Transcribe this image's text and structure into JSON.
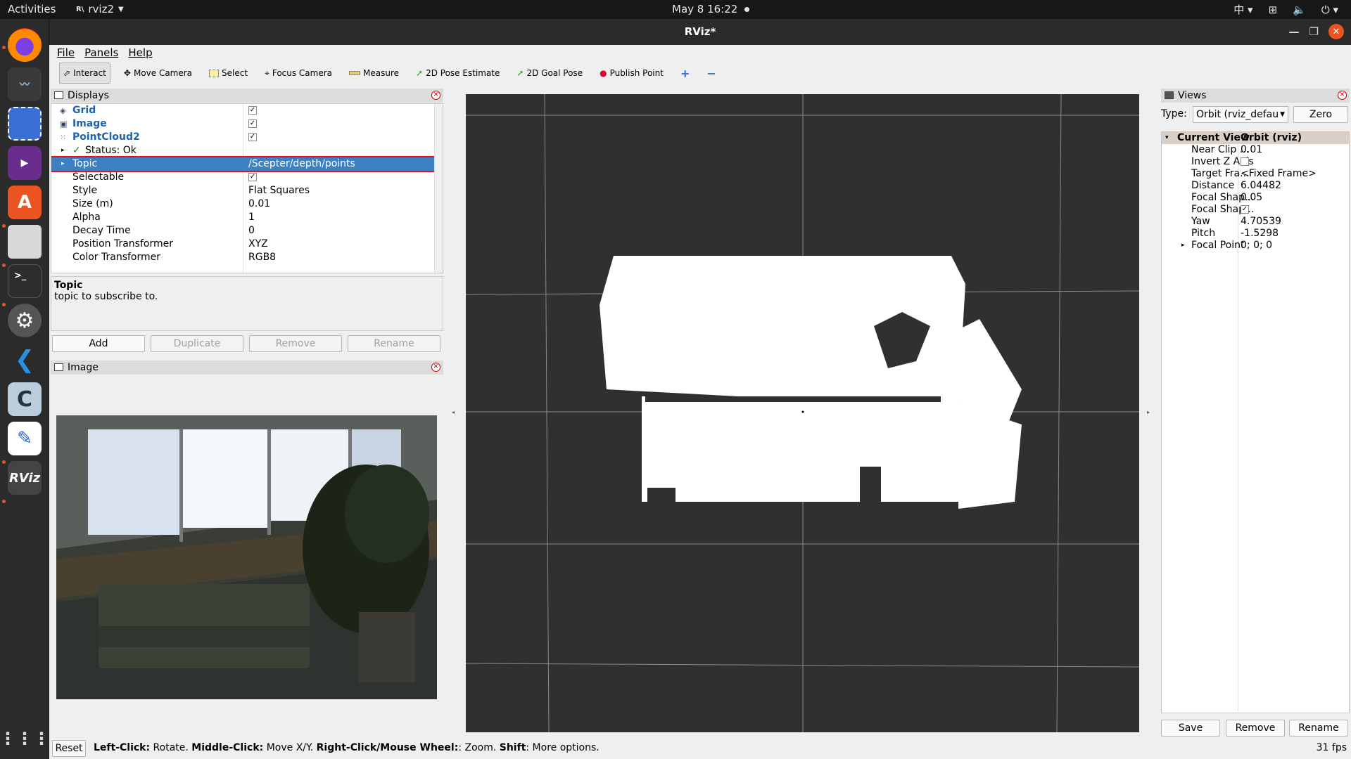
{
  "topbar": {
    "activities": "Activities",
    "app_name": "rviz2",
    "clock": "May 8  16:22",
    "lang": "中"
  },
  "window": {
    "title": "RViz*"
  },
  "menu": [
    "File",
    "Panels",
    "Help"
  ],
  "toolbar": [
    "Interact",
    "Move Camera",
    "Select",
    "Focus Camera",
    "Measure",
    "2D Pose Estimate",
    "2D Goal Pose",
    "Publish Point"
  ],
  "displays": {
    "title": "Displays",
    "rows": [
      {
        "key": "Grid",
        "value": "✓"
      },
      {
        "key": "Image",
        "value": "✓"
      },
      {
        "key": "PointCloud2",
        "value": "✓"
      },
      {
        "key": "Status: Ok",
        "value": ""
      },
      {
        "key": "Topic",
        "value": "/Scepter/depth/points"
      },
      {
        "key": "Selectable",
        "value": "✓"
      },
      {
        "key": "Style",
        "value": "Flat Squares"
      },
      {
        "key": "Size (m)",
        "value": "0.01"
      },
      {
        "key": "Alpha",
        "value": "1"
      },
      {
        "key": "Decay Time",
        "value": "0"
      },
      {
        "key": "Position Transformer",
        "value": "XYZ"
      },
      {
        "key": "Color Transformer",
        "value": "RGB8"
      }
    ],
    "desc_title": "Topic",
    "desc_text": "topic to subscribe to.",
    "buttons": {
      "add": "Add",
      "duplicate": "Duplicate",
      "remove": "Remove",
      "rename": "Rename"
    }
  },
  "image_panel": {
    "title": "Image"
  },
  "views": {
    "title": "Views",
    "type_label": "Type:",
    "type_value": "Orbit (rviz_defau",
    "zero": "Zero",
    "header_key": "Current View",
    "header_value": "Orbit (rviz)",
    "rows": [
      {
        "key": "Near Clip ...",
        "value": "0.01"
      },
      {
        "key": "Invert Z Axis",
        "value": ""
      },
      {
        "key": "Target Fra...",
        "value": "<Fixed Frame>"
      },
      {
        "key": "Distance",
        "value": "6.04482"
      },
      {
        "key": "Focal Shap...",
        "value": "0.05"
      },
      {
        "key": "Focal Shap...",
        "value": "✓"
      },
      {
        "key": "Yaw",
        "value": "4.70539"
      },
      {
        "key": "Pitch",
        "value": "-1.5298"
      },
      {
        "key": "Focal Point",
        "value": "0; 0; 0"
      }
    ],
    "buttons": {
      "save": "Save",
      "remove": "Remove",
      "rename": "Rename"
    }
  },
  "status": {
    "reset": "Reset",
    "hint_b1": "Left-Click:",
    "hint_t1": " Rotate. ",
    "hint_b2": "Middle-Click:",
    "hint_t2": " Move X/Y. ",
    "hint_b3": "Right-Click/Mouse Wheel:",
    "hint_t3": ": Zoom. ",
    "hint_b4": "Shift",
    "hint_t4": ": More options.",
    "fps": "31 fps"
  }
}
